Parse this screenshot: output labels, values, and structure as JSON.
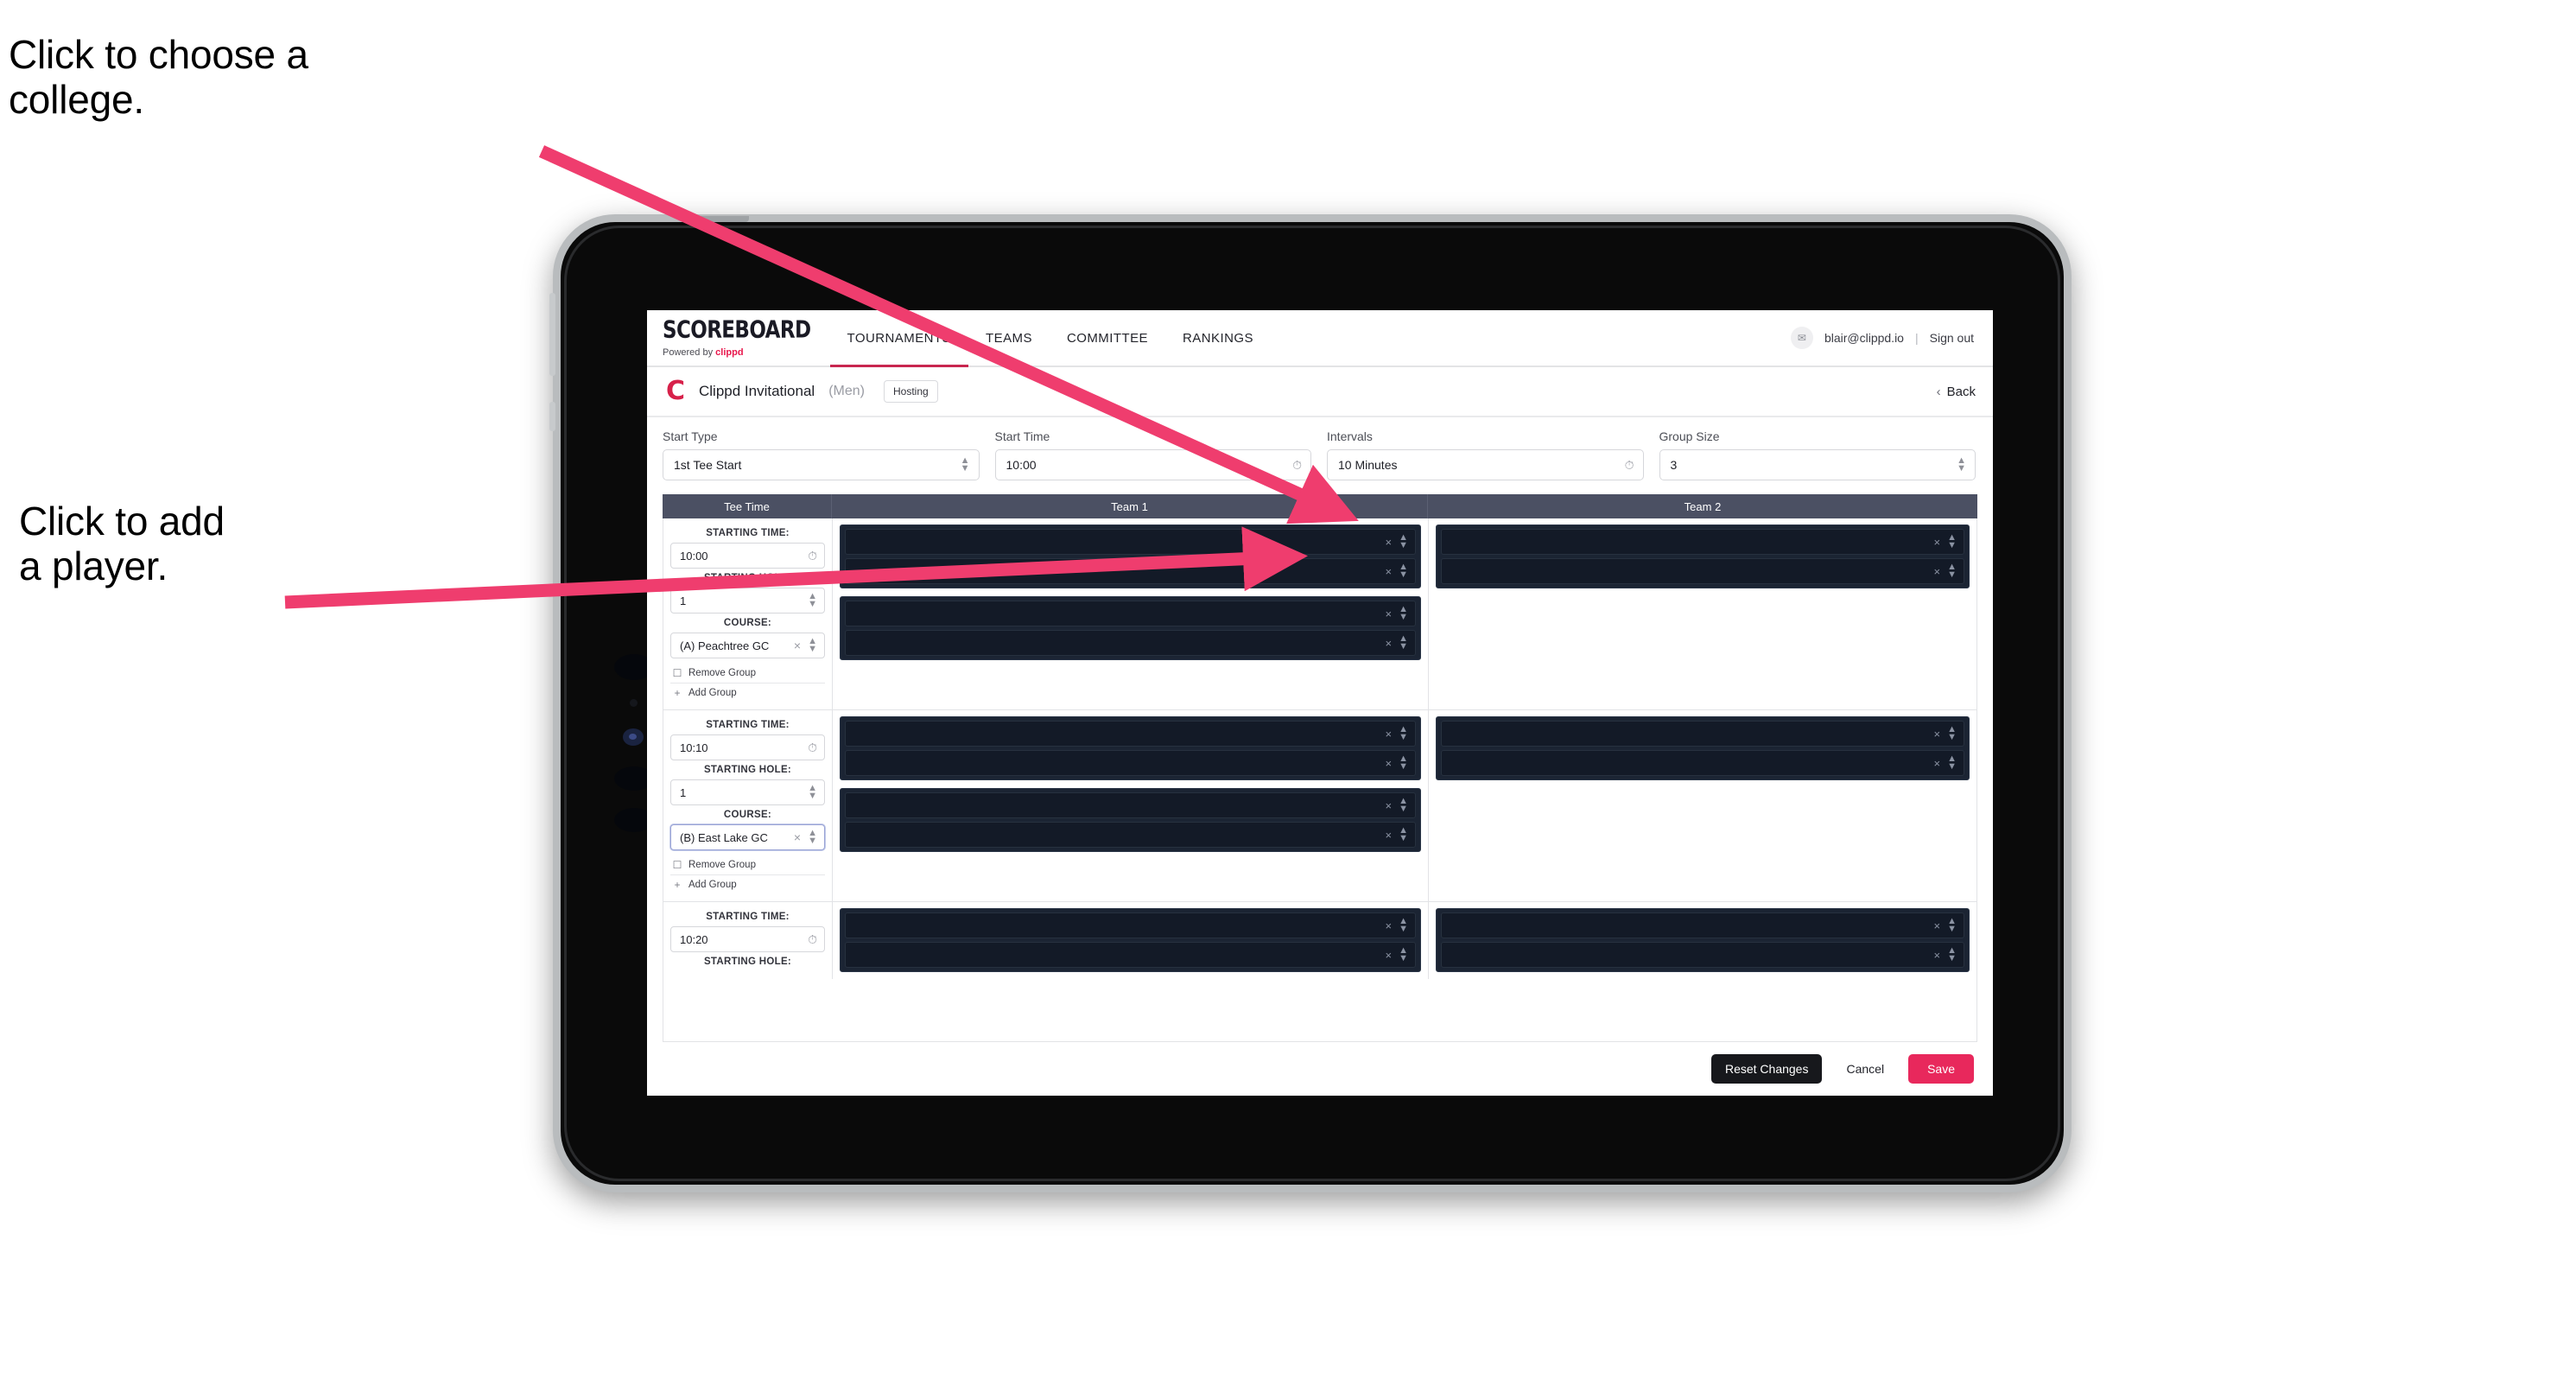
{
  "annotations": {
    "choose_college": "Click to choose a\ncollege.",
    "add_player": "Click to add\na player."
  },
  "colors": {
    "accent_pink": "#e8285c",
    "brand_red": "#d7214a",
    "nav_active_underline": "#c8264f",
    "table_header_bg": "#4b5063",
    "player_row_bg": "#131a27",
    "group_box_bg": "#1b2433",
    "reset_button_bg": "#17181c"
  },
  "topnav": {
    "brand_title": "SCOREBOARD",
    "brand_sub_prefix": "Powered by ",
    "brand_sub_name": "clippd",
    "items": [
      {
        "label": "TOURNAMENTS",
        "active": true
      },
      {
        "label": "TEAMS",
        "active": false
      },
      {
        "label": "COMMITTEE",
        "active": false
      },
      {
        "label": "RANKINGS",
        "active": false
      }
    ],
    "avatar_icon": "mail-icon",
    "user_email": "blair@clippd.io",
    "separator": "|",
    "sign_out": "Sign out"
  },
  "subhead": {
    "logo_letter": "C",
    "tournament_name": "Clippd Invitational",
    "gender": "(Men)",
    "hosting_badge": "Hosting",
    "back_label": "Back",
    "back_icon": "chevron-left-icon"
  },
  "settings": {
    "fields": [
      {
        "label": "Start Type",
        "value": "1st Tee Start",
        "icon": "stepper-icon"
      },
      {
        "label": "Start Time",
        "value": "10:00",
        "icon": "clock-icon"
      },
      {
        "label": "Intervals",
        "value": "10 Minutes",
        "icon": "clock-icon"
      },
      {
        "label": "Group Size",
        "value": "3",
        "icon": "stepper-icon"
      }
    ]
  },
  "table": {
    "headers": [
      "Tee Time",
      "Team 1",
      "Team 2"
    ],
    "labels": {
      "starting_time": "STARTING TIME:",
      "starting_hole": "STARTING HOLE:",
      "course": "COURSE:",
      "remove_group": "Remove Group",
      "add_group": "Add Group",
      "remove_icon": "trash-icon",
      "add_icon": "plus-icon",
      "clear_icon": "close-icon",
      "stepper_icon": "stepper-icon",
      "clock_icon": "clock-icon"
    },
    "rows": [
      {
        "starting_time": "10:00",
        "starting_hole": "1",
        "course": "(A) Peachtree GC",
        "course_focused": false,
        "team1_groups": [
          {
            "players": [
              "",
              ""
            ]
          },
          {
            "players": [
              "",
              ""
            ]
          }
        ],
        "team2_groups": [
          {
            "players": [
              "",
              ""
            ]
          }
        ]
      },
      {
        "starting_time": "10:10",
        "starting_hole": "1",
        "course": "(B) East Lake GC",
        "course_focused": true,
        "team1_groups": [
          {
            "players": [
              "",
              ""
            ]
          },
          {
            "players": [
              "",
              ""
            ]
          }
        ],
        "team2_groups": [
          {
            "players": [
              "",
              ""
            ]
          }
        ]
      },
      {
        "starting_time": "10:20",
        "starting_hole": "",
        "course": "",
        "course_focused": false,
        "team1_groups": [
          {
            "players": [
              "",
              ""
            ]
          }
        ],
        "team2_groups": [
          {
            "players": [
              "",
              ""
            ]
          }
        ]
      }
    ]
  },
  "footer": {
    "reset_label": "Reset Changes",
    "cancel_label": "Cancel",
    "save_label": "Save"
  }
}
